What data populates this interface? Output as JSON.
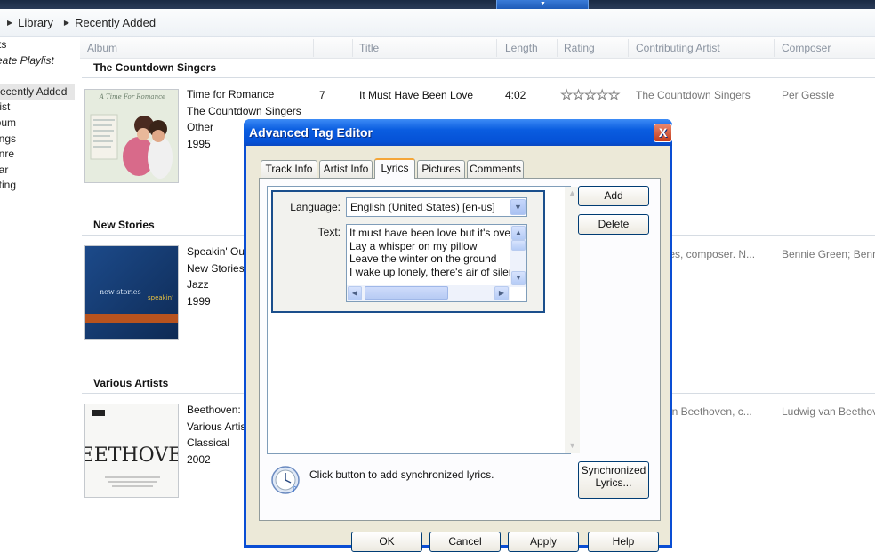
{
  "breadcrumb": {
    "library": "Library",
    "recent": "Recently Added"
  },
  "sidebar": {
    "items": [
      "sts",
      "reate Playlist",
      "y",
      "ecently Added",
      "rtist",
      "lbum",
      "ongs",
      "enre",
      "ear",
      "ating"
    ]
  },
  "columns": {
    "album": "Album",
    "title": "Title",
    "length": "Length",
    "rating": "Rating",
    "contributing": "Contributing Artist",
    "composer": "Composer"
  },
  "groups": [
    {
      "header": "The Countdown Singers",
      "meta": [
        "Time for Romance",
        "The Countdown Singers",
        "Other",
        "1995"
      ],
      "track": "7",
      "title": "It Must Have Been Love",
      "length": "4:02",
      "contributing": "The Countdown Singers",
      "composer": "Per Gessle",
      "rating": 0,
      "cover_title": "A Time For Romance"
    },
    {
      "header": "New Stories",
      "meta": [
        "Speakin' Ou",
        "New Stories",
        "Jazz",
        "1999"
      ],
      "contributing": "ales, composer. N...",
      "composer": "Bennie Green; Benn",
      "cover_title": "new stories"
    },
    {
      "header": "Various Artists",
      "meta": [
        "Beethoven:",
        "Various Artis",
        "Classical",
        "2002"
      ],
      "contributing": "van Beethoven, c...",
      "composer": "Ludwig van Beethov",
      "cover_title": "BEETHOVEN"
    }
  ],
  "dialog": {
    "title": "Advanced Tag Editor",
    "close": "X",
    "tabs": [
      "Track Info",
      "Artist Info",
      "Lyrics",
      "Pictures",
      "Comments"
    ],
    "active_tab": "Lyrics",
    "language_label": "Language:",
    "language_value": "English (United States) [en-us]",
    "text_label": "Text:",
    "lyrics_lines": [
      "It must have been love but it's ove",
      "Lay a whisper on my pillow",
      "Leave the winter on the ground",
      "I wake up lonely, there's air of siler"
    ],
    "add_label": "Add",
    "delete_label": "Delete",
    "hint": "Click button to add synchronized lyrics.",
    "sync_label_1": "Synchronized",
    "sync_label_2": "Lyrics...",
    "ok_label": "OK",
    "cancel_label": "Cancel",
    "apply_label": "Apply",
    "help_label": "Help"
  },
  "colors": {
    "titlebar": "#0a5de0",
    "dialog_bg": "#ece9d8",
    "accent_tab": "#f5a638"
  }
}
